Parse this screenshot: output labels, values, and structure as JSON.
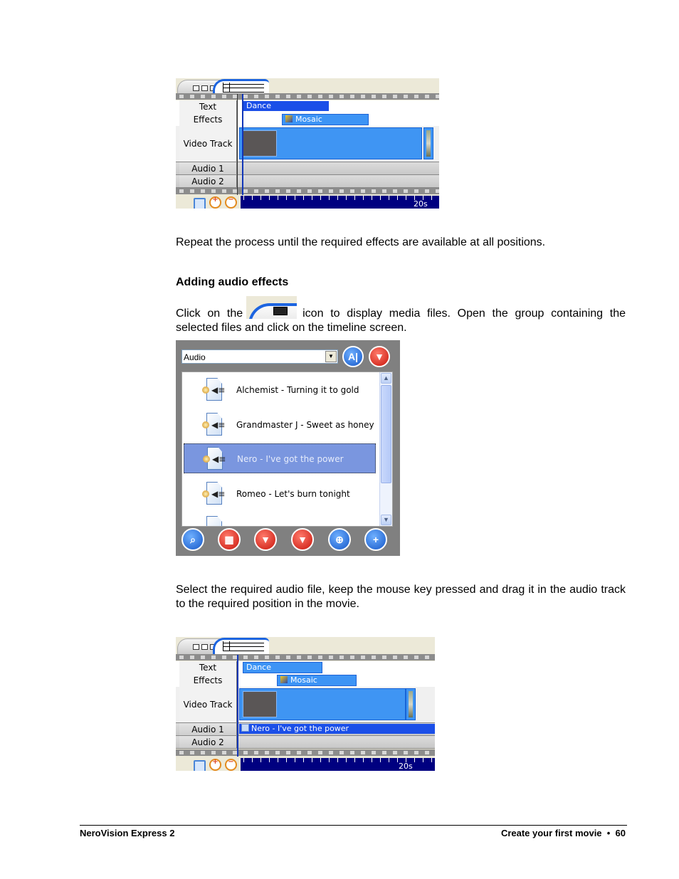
{
  "timeline1": {
    "tracks": [
      {
        "label": "Text"
      },
      {
        "label": "Effects"
      },
      {
        "label": "Video Track"
      },
      {
        "label": "Audio 1"
      },
      {
        "label": "Audio 2"
      }
    ],
    "text_clip": "Dance",
    "effects_clip": "Mosaic",
    "ruler_label": "20s"
  },
  "body": {
    "para1": "Repeat the process until the required effects are available at all positions.",
    "heading": "Adding audio effects",
    "para2_a": "Click on the",
    "para2_b": "icon to display media files. Open the group containing the selected files and click on the timeline screen.",
    "para3": "Select the required audio file, keep the mouse key pressed and drag it in the audio track to the required position in the movie."
  },
  "media_panel": {
    "dropdown_value": "Audio",
    "top_buttons": [
      {
        "name": "autoplay-button",
        "glyph": "A|"
      },
      {
        "name": "import-button",
        "glyph": "▼"
      }
    ],
    "items": [
      {
        "title": "Alchemist - Turning it to gold",
        "selected": false
      },
      {
        "title": "Grandmaster J - Sweet as honey",
        "selected": false
      },
      {
        "title": "Nero -  I've got the power",
        "selected": true
      },
      {
        "title": "Romeo -  Let's burn tonight",
        "selected": false
      }
    ],
    "bottom_buttons": [
      {
        "name": "browse-button",
        "glyph": "⌕"
      },
      {
        "name": "film-button",
        "glyph": "▦"
      },
      {
        "name": "import-down-button",
        "glyph": "▼"
      },
      {
        "name": "capture-button",
        "glyph": "▼"
      },
      {
        "name": "target-button",
        "glyph": "⊕"
      },
      {
        "name": "add-button",
        "glyph": "+"
      }
    ]
  },
  "timeline2": {
    "tracks": [
      {
        "label": "Text"
      },
      {
        "label": "Effects"
      },
      {
        "label": "Video Track"
      },
      {
        "label": "Audio 1"
      },
      {
        "label": "Audio 2"
      }
    ],
    "text_clip": "Dance",
    "effects_clip": "Mosaic",
    "audio_clip": "Nero -  I've got the power",
    "ruler_label": "20s"
  },
  "footer": {
    "left": "NeroVision Express 2",
    "right": "Create your first movie  •  60"
  }
}
